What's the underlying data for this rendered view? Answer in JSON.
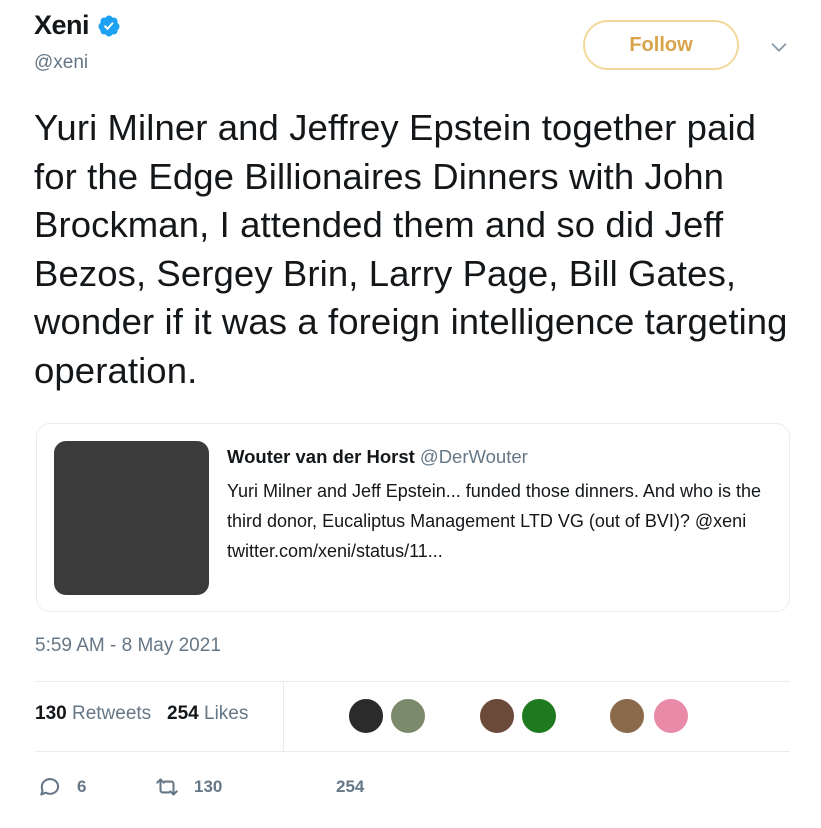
{
  "author": {
    "display_name": "Xeni",
    "handle": "@xeni",
    "verified": true,
    "verified_color": "#1da1f2"
  },
  "follow_button": {
    "label": "Follow"
  },
  "tweet": {
    "text": "Yuri Milner and Jeffrey Epstein together paid for the Edge Billionaires Dinners with John Brockman, I attended them and so did Jeff Bezos, Sergey Brin, Larry Page, Bill Gates, wonder if it was a foreign intelligence targeting operation.",
    "timestamp": "5:59 AM - 8 May 2021"
  },
  "quoted_tweet": {
    "author_name": "Wouter van der Horst",
    "author_handle": "@DerWouter",
    "text": "Yuri Milner and Jeff Epstein... funded those dinners.  And who is the third donor, Eucaliptus Management LTD VG (out of BVI)? @xeni twitter.com/xeni/status/11..."
  },
  "stats": {
    "retweets_count": "130",
    "retweets_label": "Retweets",
    "likes_count": "254",
    "likes_label": "Likes"
  },
  "likers": [
    {
      "icon": "liker-avatar",
      "color": "#2b2b2b"
    },
    {
      "icon": "liker-avatar",
      "color": "#7a8a6a"
    },
    {
      "icon": "liker-avatar",
      "color": "#6b4a3a"
    },
    {
      "icon": "liker-avatar",
      "color": "#1e7a1e"
    },
    {
      "icon": "liker-avatar",
      "color": "#8a6a4a"
    },
    {
      "icon": "liker-avatar",
      "color": "#e88aa8"
    }
  ],
  "actions": {
    "reply_count": "6",
    "retweet_count": "130",
    "like_count": "254"
  }
}
